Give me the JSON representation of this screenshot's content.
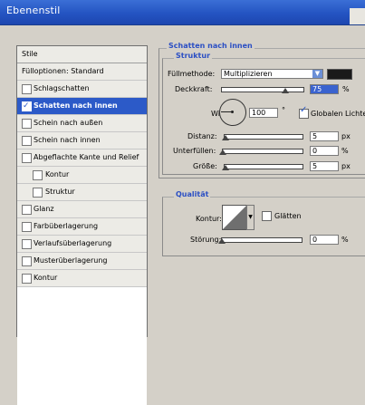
{
  "window": {
    "title": "Ebenenstil"
  },
  "styles_panel": {
    "header": "Stile",
    "items": [
      {
        "label": "Fülloptionen: Standard",
        "type": "plain",
        "checked": false
      },
      {
        "label": "Schlagschatten",
        "type": "check",
        "checked": false
      },
      {
        "label": "Schatten nach innen",
        "type": "check",
        "checked": true,
        "active": true
      },
      {
        "label": "Schein nach außen",
        "type": "check",
        "checked": false
      },
      {
        "label": "Schein nach innen",
        "type": "check",
        "checked": false
      },
      {
        "label": "Abgeflachte Kante und Relief",
        "type": "check",
        "checked": false
      },
      {
        "label": "Kontur",
        "type": "sub",
        "checked": false
      },
      {
        "label": "Struktur",
        "type": "sub",
        "checked": false
      },
      {
        "label": "Glanz",
        "type": "check",
        "checked": false
      },
      {
        "label": "Farbüberlagerung",
        "type": "check",
        "checked": false
      },
      {
        "label": "Verlaufsüberlagerung",
        "type": "check",
        "checked": false
      },
      {
        "label": "Musterüberlagerung",
        "type": "check",
        "checked": false
      },
      {
        "label": "Kontur",
        "type": "check",
        "checked": false
      }
    ]
  },
  "inner_shadow": {
    "section_title": "Schatten nach innen",
    "structure_title": "Struktur",
    "blend_mode_label": "Füllmethode:",
    "blend_mode_value": "Multiplizieren",
    "shadow_color": "#1a1a1a",
    "opacity_label": "Deckkraft:",
    "opacity_value": "75",
    "opacity_unit": "%",
    "angle_label": "Winkel:",
    "angle_value": "100",
    "angle_unit": "°",
    "global_light_label": "Globalen Lichteinfall verwenden",
    "global_light_checked": true,
    "distance_label": "Distanz:",
    "distance_value": "5",
    "distance_unit": "px",
    "choke_label": "Unterfüllen:",
    "choke_value": "0",
    "choke_unit": "%",
    "size_label": "Größe:",
    "size_value": "5",
    "size_unit": "px",
    "quality_title": "Qualität",
    "contour_label": "Kontur:",
    "antialias_label": "Glätten",
    "antialias_checked": false,
    "noise_label": "Störung:",
    "noise_value": "0",
    "noise_unit": "%"
  },
  "colors": {
    "accent": "#2c5ac8",
    "title_bar": "#2454c2",
    "panel_bg": "#d4d0c8"
  }
}
